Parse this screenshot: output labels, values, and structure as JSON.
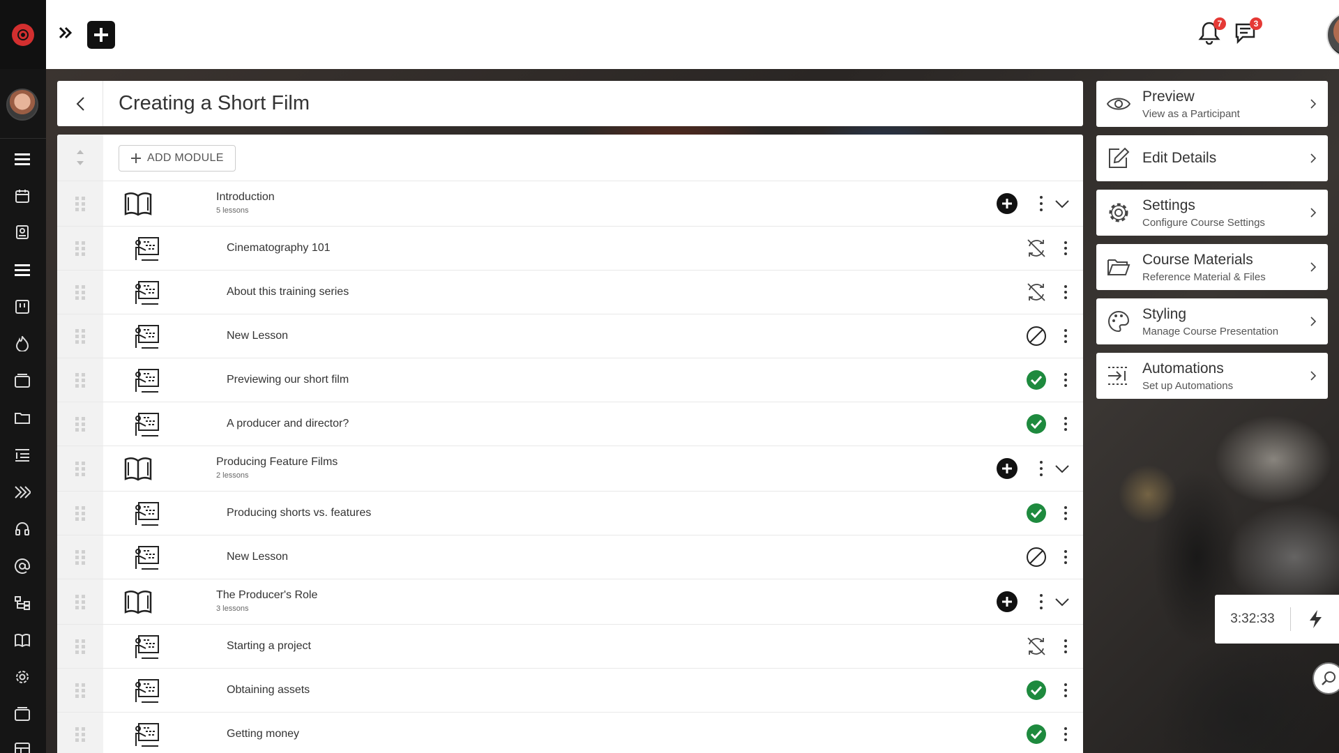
{
  "topbar": {
    "notifications_count": "7",
    "messages_count": "3"
  },
  "page": {
    "title": "Creating a Short Film",
    "add_module_label": "ADD MODULE"
  },
  "modules": [
    {
      "title": "Introduction",
      "lessons_count": "5 lessons",
      "lessons": [
        {
          "title": "Cinematography 101",
          "status": "sync-disabled"
        },
        {
          "title": "About this training series",
          "status": "sync-disabled"
        },
        {
          "title": "New Lesson",
          "status": "blocked"
        },
        {
          "title": "Previewing our short film",
          "status": "complete"
        },
        {
          "title": "A producer and director?",
          "status": "complete"
        }
      ]
    },
    {
      "title": "Producing Feature Films",
      "lessons_count": "2 lessons",
      "lessons": [
        {
          "title": "Producing shorts vs. features",
          "status": "complete"
        },
        {
          "title": "New Lesson",
          "status": "blocked"
        }
      ]
    },
    {
      "title": "The Producer's Role",
      "lessons_count": "3 lessons",
      "lessons": [
        {
          "title": "Starting a project",
          "status": "sync-disabled"
        },
        {
          "title": "Obtaining assets",
          "status": "complete"
        },
        {
          "title": "Getting money",
          "status": "complete"
        }
      ]
    }
  ],
  "right_panel": [
    {
      "title": "Preview",
      "subtitle": "View as a Participant",
      "icon": "eye-icon"
    },
    {
      "title": "Edit Details",
      "subtitle": "",
      "icon": "edit-icon"
    },
    {
      "title": "Settings",
      "subtitle": "Configure Course Settings",
      "icon": "gear-icon"
    },
    {
      "title": "Course Materials",
      "subtitle": "Reference Material & Files",
      "icon": "folder-icon"
    },
    {
      "title": "Styling",
      "subtitle": "Manage Course Presentation",
      "icon": "palette-icon"
    },
    {
      "title": "Automations",
      "subtitle": "Set up Automations",
      "icon": "automation-icon"
    }
  ],
  "timer": {
    "value": "3:32:33"
  },
  "colors": {
    "complete": "#1e8a3e",
    "brand": "#d32f2f",
    "badge": "#e53935"
  }
}
